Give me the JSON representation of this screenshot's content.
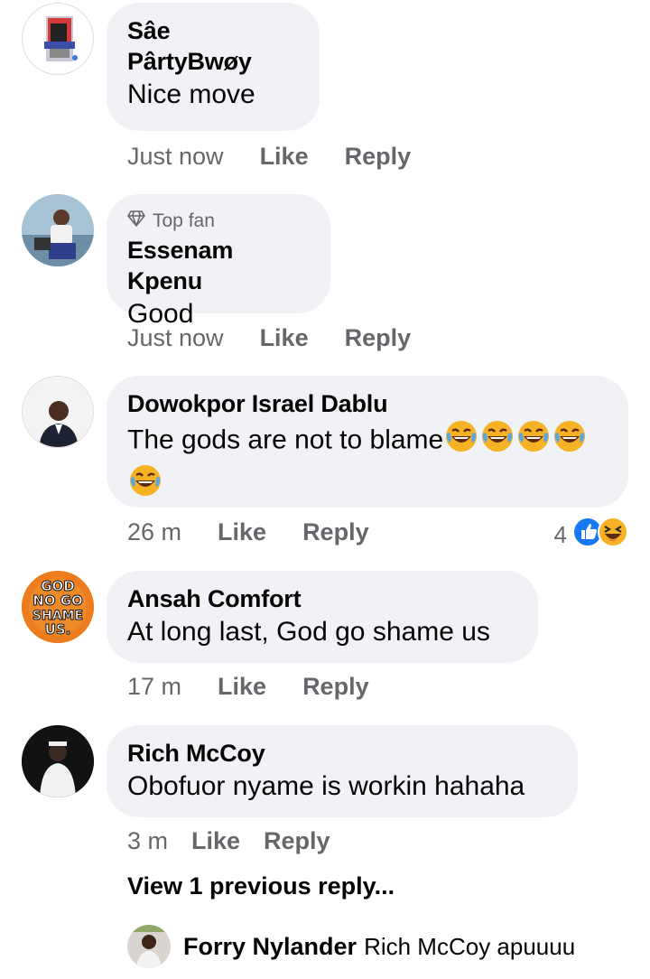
{
  "comments": [
    {
      "author": "Sâe PârtyBwøy",
      "text": "Nice move",
      "badge": "",
      "time": "Just now",
      "like": "Like",
      "reply": "Reply"
    },
    {
      "author": "Essenam Kpenu",
      "text": "Good",
      "badge": "Top fan",
      "time": "Just now",
      "like": "Like",
      "reply": "Reply"
    },
    {
      "author": "Dowokpor Israel Dablu",
      "text": "The gods are not to blame",
      "emoji_count": 5,
      "time": "26 m",
      "like": "Like",
      "reply": "Reply",
      "reaction_count": "4",
      "reaction_icons": [
        "like-reaction-icon",
        "haha-reaction-icon"
      ]
    },
    {
      "author": "Ansah Comfort",
      "text": "At long last, God go shame us",
      "avatar_text": [
        "GOD",
        "NO GO",
        "SHAME",
        "US."
      ],
      "time": "17 m",
      "like": "Like",
      "reply": "Reply"
    },
    {
      "author": "Rich McCoy",
      "text": "Obofuor nyame is workin hahaha",
      "time": "3 m",
      "like": "Like",
      "reply": "Reply"
    }
  ],
  "view_previous": "View 1 previous reply...",
  "reply_preview": {
    "author": "Forry Nylander",
    "text": "Rich McCoy apuuuu"
  },
  "colors": {
    "bubble": "#f0f2f5",
    "meta": "#65676b",
    "like_blue": "#1877f2",
    "haha_yellow": "#f7b125"
  }
}
